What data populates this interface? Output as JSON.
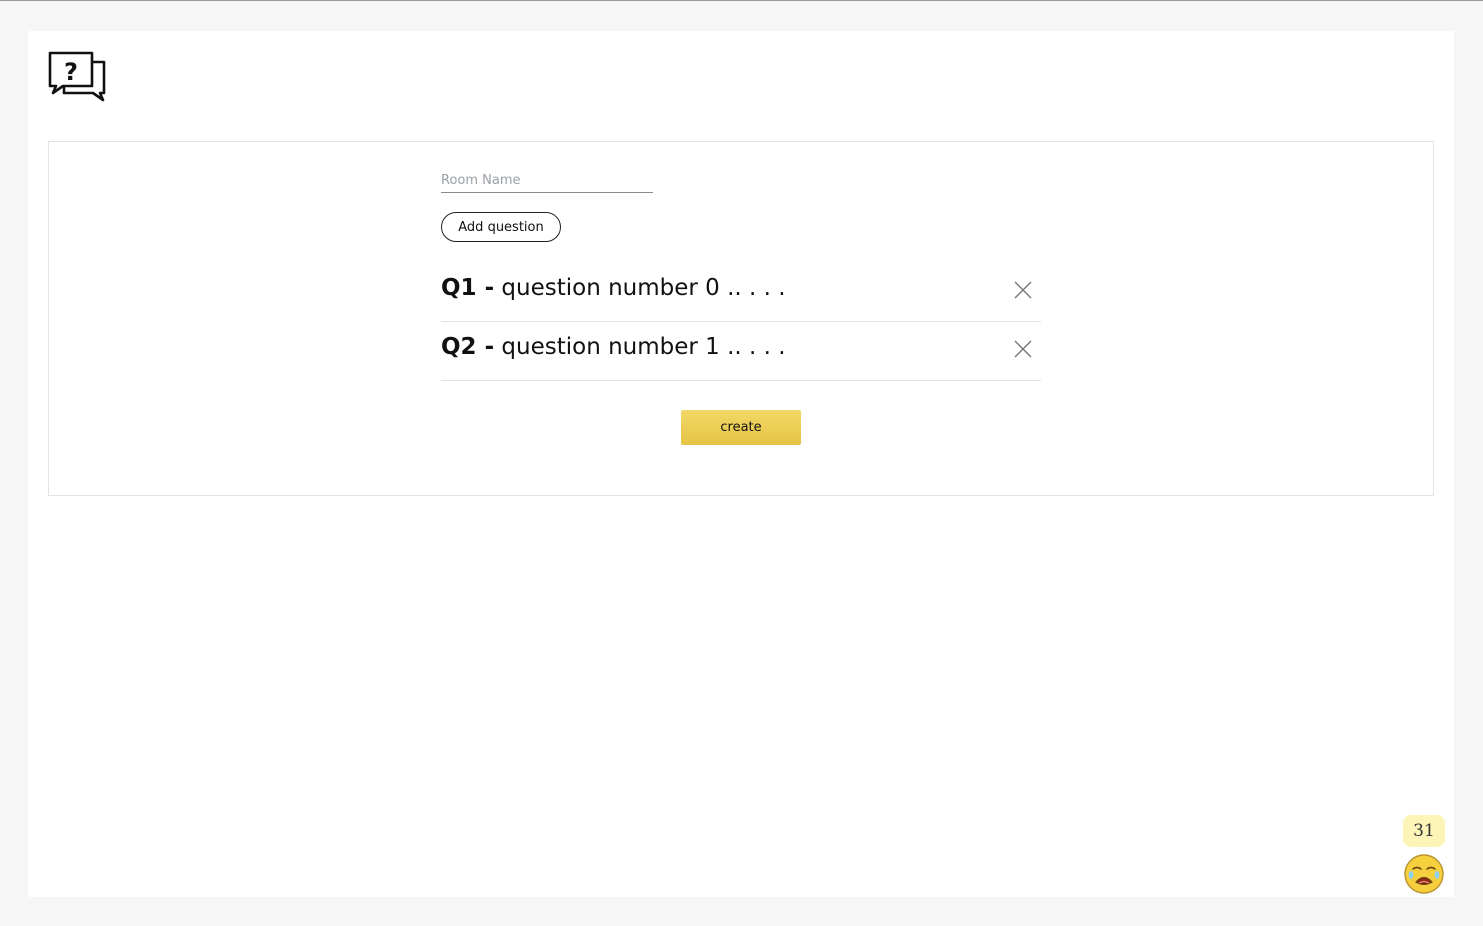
{
  "room_form": {
    "room_name_placeholder": "Room Name",
    "room_name_value": "",
    "add_question_label": "Add question",
    "create_label": "create"
  },
  "questions": [
    {
      "number": "Q1 -",
      "text": "question number 0 .. . . ."
    },
    {
      "number": "Q2 -",
      "text": "question number 1 .. . . ."
    }
  ],
  "widget": {
    "count": "31",
    "emoji_icon": "crying-face-icon"
  },
  "logo_icon": "question-chat-bubbles-icon",
  "colors": {
    "accent": "#ecd157",
    "badge_bg": "#fdf5b8"
  }
}
